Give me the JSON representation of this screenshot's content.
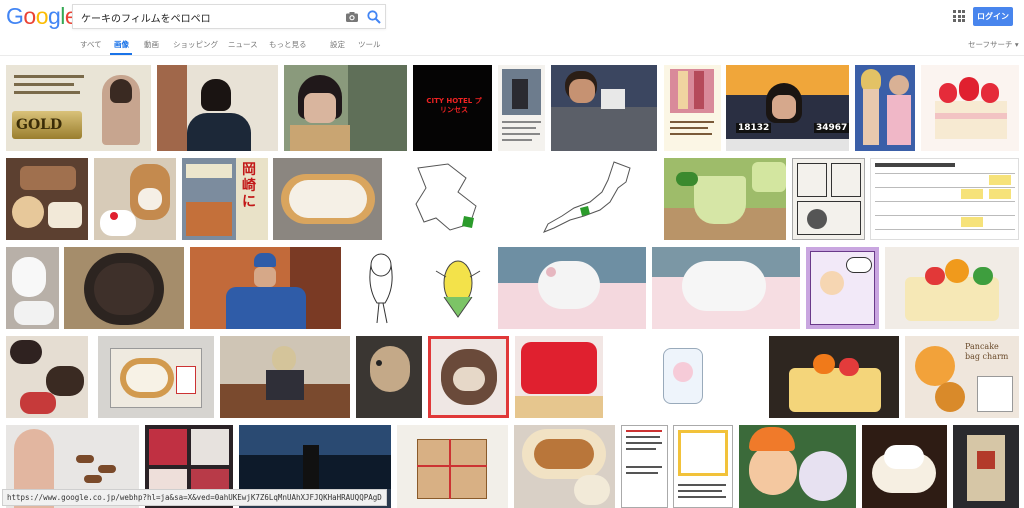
{
  "logo": {
    "letters": [
      "G",
      "o",
      "o",
      "g",
      "l",
      "e"
    ],
    "colors": [
      "#4285f4",
      "#ea4335",
      "#fbbc05",
      "#4285f4",
      "#34a853",
      "#ea4335"
    ]
  },
  "search": {
    "value": "ケーキのフィルムをペロペロ"
  },
  "header": {
    "login_label": "ログイン"
  },
  "tabs": {
    "all": "すべて",
    "images": "画像",
    "videos": "動画",
    "shopping": "ショッピング",
    "news": "ニュース",
    "more": "もっと見る",
    "settings": "設定",
    "tools": "ツール",
    "safesearch": "セーフサーチ ▾"
  },
  "accent_color": "#1a73e8",
  "thumb_texts": {
    "gold_card": "GOLD",
    "hotel": "CITY HOTEL プリンセス",
    "score_left": "18132",
    "score_right": "34967",
    "pancake": "Pancake bag charm",
    "book": "岡崎に"
  },
  "status_url": "https://www.google.co.jp/webhp?hl=ja&sa=X&ved=0ahUKEwjK7Z6LqMnUAhXJFJQKHaHRAUQQPAgD"
}
